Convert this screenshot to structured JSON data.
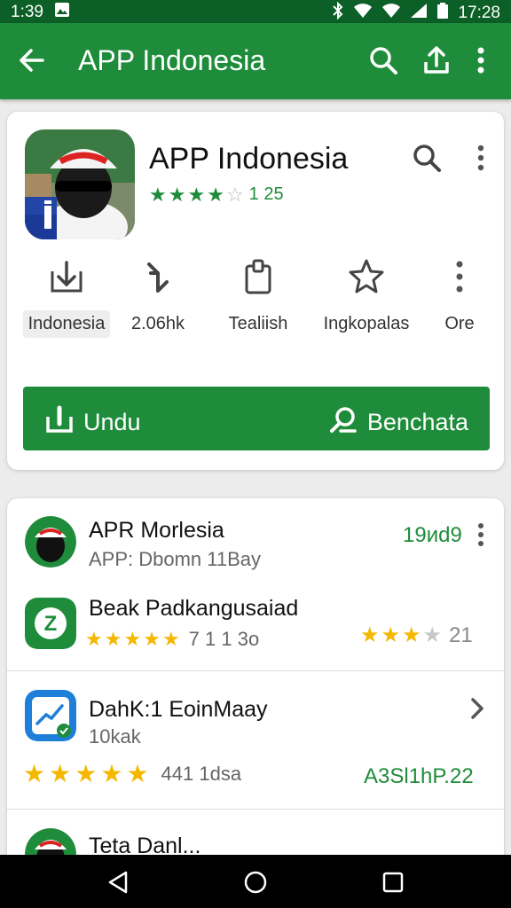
{
  "status_bar": {
    "left_text": "1:39",
    "time": "17:28",
    "icons": [
      "image-icon",
      "bluetooth-icon",
      "wifi-icon",
      "wifi-icon",
      "signal-icon",
      "battery-icon"
    ]
  },
  "app_bar": {
    "title": "APP Indonesia",
    "icons": [
      "back-arrow-icon",
      "search-icon",
      "share-icon",
      "more-vert-icon"
    ]
  },
  "app_header": {
    "title": "APP Indonesia",
    "rating_text": "1 25",
    "stars": 3.5
  },
  "actions": [
    {
      "label": "Indonesia",
      "icon": "download-icon",
      "selected": true
    },
    {
      "label": "2.06hk",
      "icon": "share-arrow-icon",
      "selected": false
    },
    {
      "label": "Tealiish",
      "icon": "clipboard-icon",
      "selected": false
    },
    {
      "label": "Ingkopalas",
      "icon": "star-outline-icon",
      "selected": false
    },
    {
      "label": "Ore",
      "icon": "more-vert-icon",
      "selected": false
    }
  ],
  "primary_button": {
    "left_label": "Undu",
    "right_label": "Benchata",
    "left_icon": "download-icon",
    "right_icon": "leaf-icon"
  },
  "list": [
    {
      "title": "APR Morlesia",
      "subtitle": "APP: Dbomn 11Bay",
      "right_text": "19иd9",
      "icon": "helmet-app-icon"
    },
    {
      "title": "Beak Padkangusaiad",
      "subtitle_stars": 4.5,
      "subtitle_text": "7 1 1 3o",
      "right_stars": 2.5,
      "right_text": "21",
      "icon": "z-app-icon"
    },
    {
      "title": "DahK:1 EoinMaay",
      "subtitle": "10kak",
      "icon": "chart-app-icon"
    },
    {
      "title": "",
      "subtitle_stars": 5,
      "subtitle_text": "441 1dsa",
      "right_text": "A3Sl1hP.22"
    },
    {
      "title": "Teta Danl...",
      "icon": "helmet-app-icon"
    }
  ],
  "colors": {
    "primary": "#1e8c3a",
    "status_bar": "#0b5f27",
    "star_yellow": "#f5b800"
  }
}
